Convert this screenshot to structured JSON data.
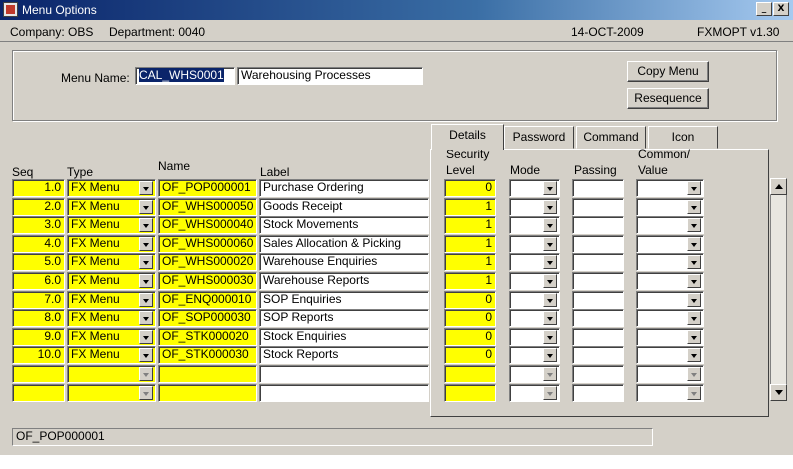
{
  "window": {
    "title": "Menu Options",
    "min_btn": "_",
    "close_btn": "X"
  },
  "info": {
    "company": "Company: OBS",
    "department": "Department: 0040",
    "date": "14-OCT-2009",
    "form": "FXMOPT v1.30"
  },
  "header": {
    "menu_name_label": "Menu Name:",
    "menu_code": "CAL_WHS0001",
    "menu_desc": "Warehousing Processes",
    "copy_button": "Copy Menu",
    "resequence_button": "Resequence"
  },
  "tabs": [
    "Details",
    "Password",
    "Command",
    "Icon"
  ],
  "columns": {
    "seq": "Seq",
    "type": "Type",
    "name": "Name",
    "label": "Label",
    "security_1": "Security",
    "security_2": "Level",
    "mode": "Mode",
    "passing": "Passing",
    "common_1": "Common/",
    "common_2": "Value"
  },
  "rows": [
    {
      "seq": "1.0",
      "type": "FX Menu",
      "name": "OF_POP000001",
      "label": "Purchase Ordering",
      "security": "0"
    },
    {
      "seq": "2.0",
      "type": "FX Menu",
      "name": "OF_WHS000050",
      "label": "Goods Receipt",
      "security": "1"
    },
    {
      "seq": "3.0",
      "type": "FX Menu",
      "name": "OF_WHS000040",
      "label": "Stock Movements",
      "security": "1"
    },
    {
      "seq": "4.0",
      "type": "FX Menu",
      "name": "OF_WHS000060",
      "label": "Sales Allocation & Picking",
      "security": "1"
    },
    {
      "seq": "5.0",
      "type": "FX Menu",
      "name": "OF_WHS000020",
      "label": "Warehouse Enquiries",
      "security": "1"
    },
    {
      "seq": "6.0",
      "type": "FX Menu",
      "name": "OF_WHS000030",
      "label": "Warehouse Reports",
      "security": "1"
    },
    {
      "seq": "7.0",
      "type": "FX Menu",
      "name": "OF_ENQ000010",
      "label": "SOP Enquiries",
      "security": "0"
    },
    {
      "seq": "8.0",
      "type": "FX Menu",
      "name": "OF_SOP000030",
      "label": "SOP Reports",
      "security": "0"
    },
    {
      "seq": "9.0",
      "type": "FX Menu",
      "name": "OF_STK000020",
      "label": "Stock Enquiries",
      "security": "0"
    },
    {
      "seq": "10.0",
      "type": "FX Menu",
      "name": "OF_STK000030",
      "label": "Stock Reports",
      "security": "0"
    },
    {
      "seq": "",
      "type": "",
      "name": "",
      "label": "",
      "security": ""
    },
    {
      "seq": "",
      "type": "",
      "name": "",
      "label": "",
      "security": ""
    }
  ],
  "status": {
    "current": "OF_POP000001"
  },
  "colors": {
    "required_field": "#ffff00",
    "title_bar": "#0a246a",
    "face": "#d4d0c8"
  }
}
